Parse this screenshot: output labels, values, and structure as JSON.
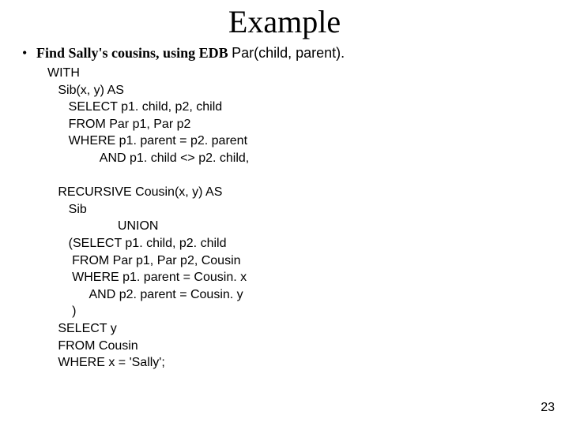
{
  "title": "Example",
  "bullet_glyph": "•",
  "prompt_text": "Find Sally's cousins, using EDB ",
  "edb_text": "Par(child, parent).",
  "code_lines": [
    "WITH",
    "   Sib(x, y) AS",
    "      SELECT p1. child, p2, child",
    "      FROM Par p1, Par p2",
    "      WHERE p1. parent = p2. parent",
    "               AND p1. child <> p2. child,",
    "",
    "   RECURSIVE Cousin(x, y) AS",
    "      Sib",
    "                    UNION",
    "      (SELECT p1. child, p2. child",
    "       FROM Par p1, Par p2, Cousin",
    "       WHERE p1. parent = Cousin. x",
    "            AND p2. parent = Cousin. y",
    "       )",
    "   SELECT y",
    "   FROM Cousin",
    "   WHERE x = 'Sally';"
  ],
  "page_number": "23"
}
